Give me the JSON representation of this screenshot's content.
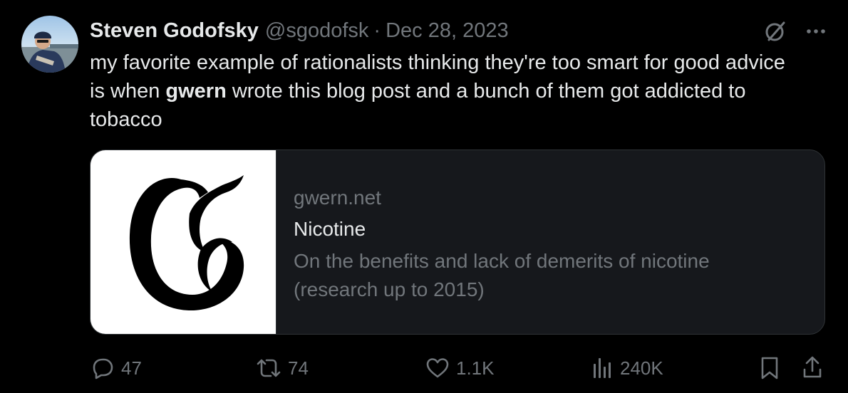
{
  "post": {
    "author_name": "Steven Godofsky",
    "author_handle": "@sgodofsk",
    "separator": "·",
    "date": "Dec 28, 2023",
    "text_before": "my favorite example of rationalists thinking they're too smart for good advice is when ",
    "text_bold": "gwern",
    "text_after": " wrote this blog post and a bunch of them got addicted to tobacco"
  },
  "link_card": {
    "logo_letter": "G",
    "domain": "gwern.net",
    "title": "Nicotine",
    "description": "On the benefits and lack of demerits of nicotine (research up to 2015)"
  },
  "actions": {
    "replies": "47",
    "reposts": "74",
    "likes": "1.1K",
    "views": "240K"
  },
  "colors": {
    "background": "#000000",
    "primary_text": "#e7e9ea",
    "secondary_text": "#71767b",
    "card_border": "#2f3336"
  },
  "icons": {
    "avatar": "avatar-photo",
    "grok": "grok-icon",
    "more": "more-icon",
    "reply": "reply-icon",
    "repost": "repost-icon",
    "like": "heart-icon",
    "views": "views-icon",
    "bookmark": "bookmark-icon",
    "share": "share-icon"
  }
}
